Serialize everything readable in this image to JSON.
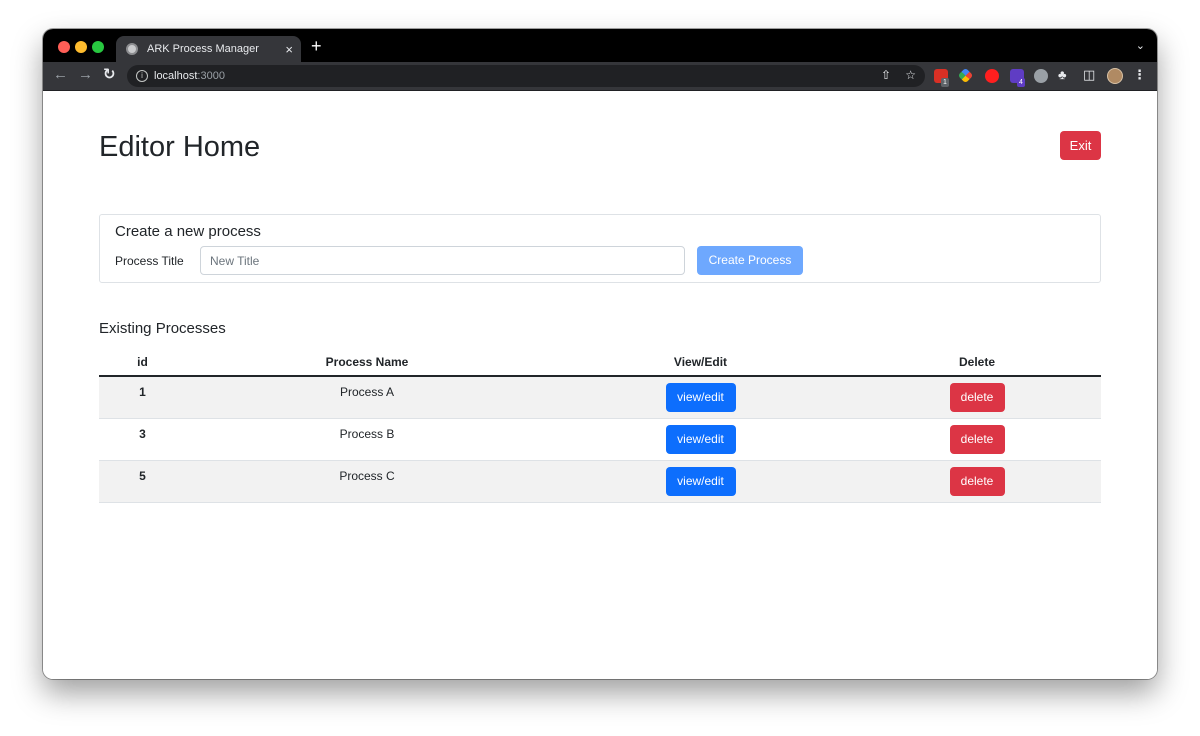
{
  "browser": {
    "tab_title": "ARK Process Manager",
    "tab_close": "×",
    "new_tab": "+",
    "url_host": "localhost",
    "url_port": ":3000",
    "extension_badge_1": "1",
    "extension_badge_2": "4"
  },
  "page": {
    "title": "Editor Home",
    "exit_label": "Exit"
  },
  "create": {
    "heading": "Create a new process",
    "label": "Process Title",
    "input_value": "",
    "placeholder": "New Title",
    "button_label": "Create Process"
  },
  "processes": {
    "heading": "Existing Processes",
    "columns": [
      "id",
      "Process Name",
      "View/Edit",
      "Delete"
    ],
    "rows": [
      {
        "id": "1",
        "name": "Process A",
        "view_label": "view/edit",
        "delete_label": "delete"
      },
      {
        "id": "3",
        "name": "Process B",
        "view_label": "view/edit",
        "delete_label": "delete"
      },
      {
        "id": "5",
        "name": "Process C",
        "view_label": "view/edit",
        "delete_label": "delete"
      }
    ]
  },
  "colors": {
    "primary": "#0d6efd",
    "primary_disabled": "#6ea8fe",
    "danger": "#dc3545",
    "stripe": "#f2f2f2"
  }
}
